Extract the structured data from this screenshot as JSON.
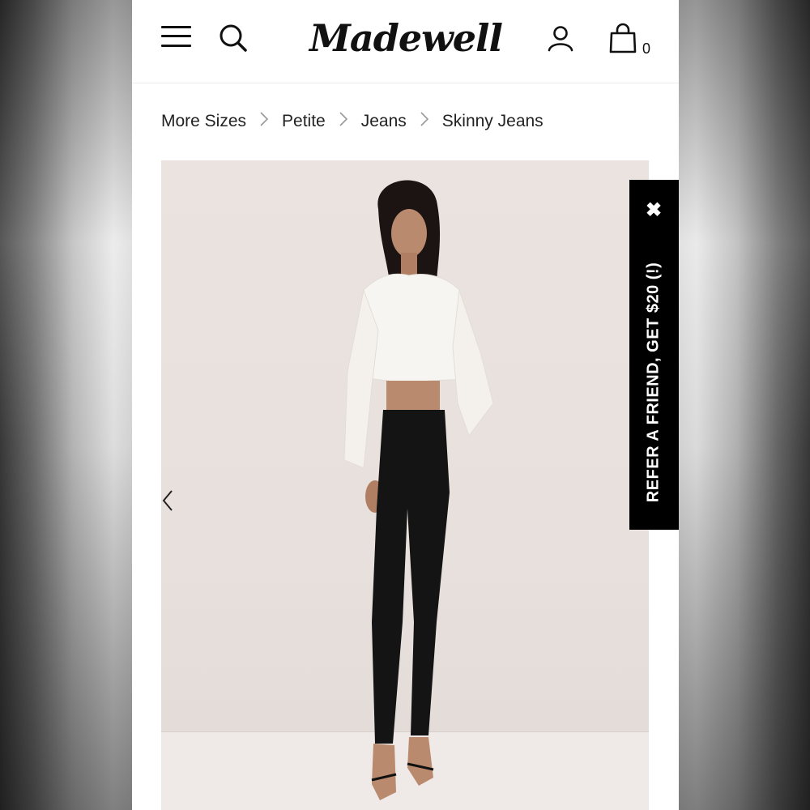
{
  "header": {
    "logo_text": "Madewell",
    "bag_count": "0",
    "icons": [
      "menu-icon",
      "search-icon",
      "account-icon",
      "bag-icon"
    ]
  },
  "breadcrumb": {
    "items": [
      "More Sizes",
      "Petite",
      "Jeans",
      "Skinny Jeans"
    ],
    "separator": ">"
  },
  "gallery": {
    "prev_icon": "chevron-left-icon"
  },
  "referral": {
    "text": "REFER A FRIEND, GET $20 (!)",
    "close_label": "✖"
  },
  "colors": {
    "background": "#ffffff",
    "text": "#111111",
    "referral_bg": "#000000",
    "hero_bg": "#ebe3df"
  }
}
